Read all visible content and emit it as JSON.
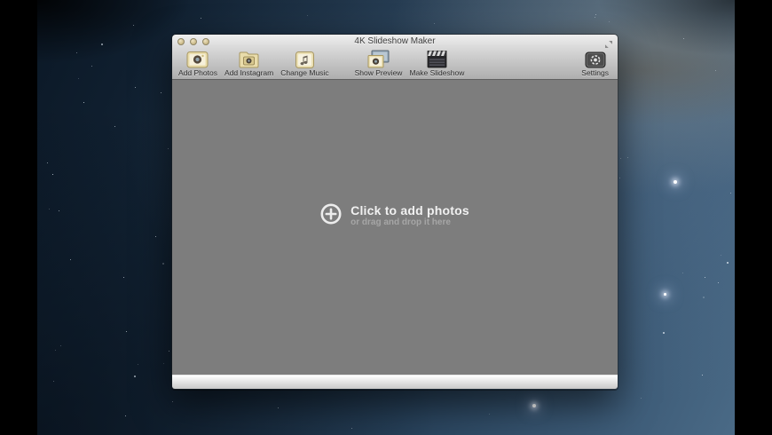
{
  "window": {
    "title": "4K Slideshow Maker",
    "titlebar": {
      "close_label": "",
      "minimize_label": "",
      "zoom_label": ""
    },
    "toolbar": {
      "items": [
        {
          "label": "Add Photos",
          "icon": "add-photos-icon"
        },
        {
          "label": "Add Instagram",
          "icon": "add-instagram-icon"
        },
        {
          "label": "Change Music",
          "icon": "change-music-icon"
        },
        {
          "label": "Show Preview",
          "icon": "show-preview-icon"
        },
        {
          "label": "Make Slideshow",
          "icon": "make-slideshow-icon"
        }
      ],
      "settings": {
        "label": "Settings",
        "icon": "settings-icon"
      }
    },
    "dropzone": {
      "title": "Click to add photos",
      "subtitle": "or drag and drop it here",
      "icon": "plus-circle-icon"
    }
  },
  "colors": {
    "content_background": "#7d7d7d",
    "chrome_top": "#efefef",
    "chrome_bottom": "#aeaeae",
    "dropzone_title_text": "#f1f1f1",
    "dropzone_subtitle_text": "#a6a6a6",
    "wallpaper_navy": "#16293c",
    "pillarbox": "#000000"
  }
}
